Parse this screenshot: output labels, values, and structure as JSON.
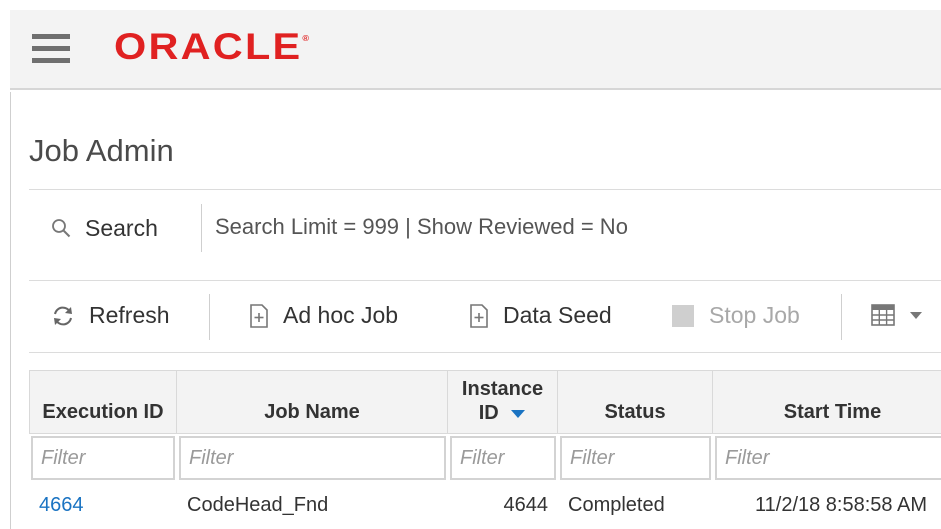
{
  "header": {
    "brand": "ORACLE",
    "brand_mark": "®",
    "menu_icon": "hamburger-menu-icon",
    "brand_color": "#e02121"
  },
  "page": {
    "title": "Job Admin"
  },
  "search": {
    "button_label": "Search",
    "icon": "search-icon",
    "summary": "Search Limit = 999 | Show Reviewed = No"
  },
  "toolbar": {
    "refresh_label": "Refresh",
    "refresh_icon": "refresh-icon",
    "adhoc_label": "Ad hoc Job",
    "adhoc_icon": "add-document-icon",
    "dataseed_label": "Data Seed",
    "dataseed_icon": "add-document-icon",
    "stopjob_label": "Stop Job",
    "stopjob_icon": "stop-icon",
    "columns_icon": "table-columns-icon",
    "columns_menu_icon": "caret-down-icon"
  },
  "table": {
    "columns": [
      {
        "label": "Execution ID"
      },
      {
        "label": "Job Name"
      },
      {
        "label": "Instance",
        "label2": "ID",
        "sort_icon": "sort-descending-icon"
      },
      {
        "label": "Status"
      },
      {
        "label": "Start Time"
      }
    ],
    "filter_placeholder": "Filter",
    "rows": [
      {
        "execution_id": "4664",
        "job_name": "CodeHead_Fnd",
        "instance_id": "4644",
        "status": "Completed",
        "start_time": "11/2/18 8:58:58 AM"
      }
    ],
    "link_color": "#1a73c2",
    "sort_color": "#1a73c2"
  }
}
